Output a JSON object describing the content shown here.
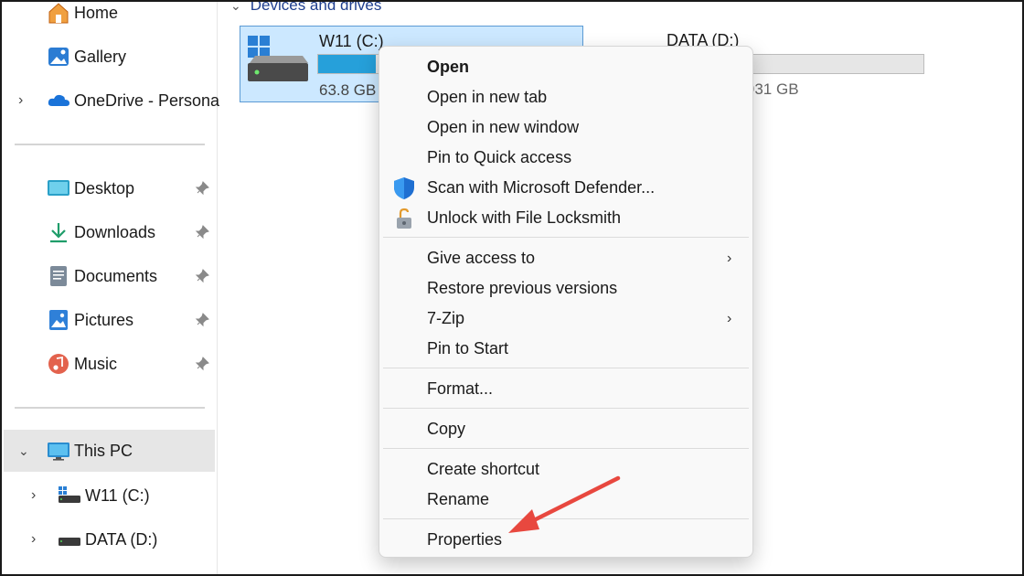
{
  "sidebar": {
    "items": [
      {
        "label": "Home"
      },
      {
        "label": "Gallery"
      },
      {
        "label": "OneDrive - Persona"
      },
      {
        "label": "Desktop"
      },
      {
        "label": "Downloads"
      },
      {
        "label": "Documents"
      },
      {
        "label": "Pictures"
      },
      {
        "label": "Music"
      },
      {
        "label": "This PC"
      },
      {
        "label": "W11 (C:)"
      },
      {
        "label": "DATA (D:)"
      }
    ]
  },
  "main": {
    "section": "Devices and drives",
    "drives": [
      {
        "name": "W11 (C:)",
        "size_text": "63.8 GB",
        "usage_fraction": 0.22
      },
      {
        "name": "DATA (D:)",
        "size_text": "of 931 GB",
        "usage_fraction": 0.0
      }
    ]
  },
  "context_menu": {
    "items": [
      {
        "label": "Open"
      },
      {
        "label": "Open in new tab"
      },
      {
        "label": "Open in new window"
      },
      {
        "label": "Pin to Quick access"
      },
      {
        "label": "Scan with Microsoft Defender..."
      },
      {
        "label": "Unlock with File Locksmith"
      },
      {
        "label": "Give access to"
      },
      {
        "label": "Restore previous versions"
      },
      {
        "label": "7-Zip"
      },
      {
        "label": "Pin to Start"
      },
      {
        "label": "Format..."
      },
      {
        "label": "Copy"
      },
      {
        "label": "Create shortcut"
      },
      {
        "label": "Rename"
      },
      {
        "label": "Properties"
      }
    ],
    "submenu_glyph": "›"
  },
  "colors": {
    "accent": "#26a0da",
    "selection": "#cce8ff",
    "annotation_arrow": "#e8483f"
  }
}
